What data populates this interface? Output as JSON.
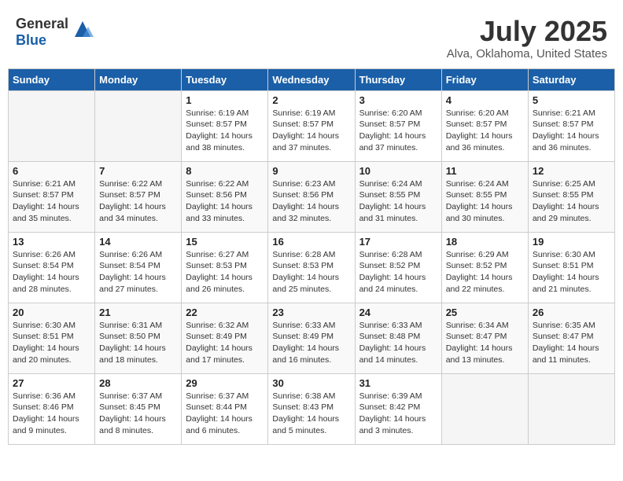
{
  "header": {
    "logo_general": "General",
    "logo_blue": "Blue",
    "month": "July 2025",
    "location": "Alva, Oklahoma, United States"
  },
  "weekdays": [
    "Sunday",
    "Monday",
    "Tuesday",
    "Wednesday",
    "Thursday",
    "Friday",
    "Saturday"
  ],
  "weeks": [
    [
      {
        "day": "",
        "sunrise": "",
        "sunset": "",
        "daylight": ""
      },
      {
        "day": "",
        "sunrise": "",
        "sunset": "",
        "daylight": ""
      },
      {
        "day": "1",
        "sunrise": "Sunrise: 6:19 AM",
        "sunset": "Sunset: 8:57 PM",
        "daylight": "Daylight: 14 hours and 38 minutes."
      },
      {
        "day": "2",
        "sunrise": "Sunrise: 6:19 AM",
        "sunset": "Sunset: 8:57 PM",
        "daylight": "Daylight: 14 hours and 37 minutes."
      },
      {
        "day": "3",
        "sunrise": "Sunrise: 6:20 AM",
        "sunset": "Sunset: 8:57 PM",
        "daylight": "Daylight: 14 hours and 37 minutes."
      },
      {
        "day": "4",
        "sunrise": "Sunrise: 6:20 AM",
        "sunset": "Sunset: 8:57 PM",
        "daylight": "Daylight: 14 hours and 36 minutes."
      },
      {
        "day": "5",
        "sunrise": "Sunrise: 6:21 AM",
        "sunset": "Sunset: 8:57 PM",
        "daylight": "Daylight: 14 hours and 36 minutes."
      }
    ],
    [
      {
        "day": "6",
        "sunrise": "Sunrise: 6:21 AM",
        "sunset": "Sunset: 8:57 PM",
        "daylight": "Daylight: 14 hours and 35 minutes."
      },
      {
        "day": "7",
        "sunrise": "Sunrise: 6:22 AM",
        "sunset": "Sunset: 8:57 PM",
        "daylight": "Daylight: 14 hours and 34 minutes."
      },
      {
        "day": "8",
        "sunrise": "Sunrise: 6:22 AM",
        "sunset": "Sunset: 8:56 PM",
        "daylight": "Daylight: 14 hours and 33 minutes."
      },
      {
        "day": "9",
        "sunrise": "Sunrise: 6:23 AM",
        "sunset": "Sunset: 8:56 PM",
        "daylight": "Daylight: 14 hours and 32 minutes."
      },
      {
        "day": "10",
        "sunrise": "Sunrise: 6:24 AM",
        "sunset": "Sunset: 8:55 PM",
        "daylight": "Daylight: 14 hours and 31 minutes."
      },
      {
        "day": "11",
        "sunrise": "Sunrise: 6:24 AM",
        "sunset": "Sunset: 8:55 PM",
        "daylight": "Daylight: 14 hours and 30 minutes."
      },
      {
        "day": "12",
        "sunrise": "Sunrise: 6:25 AM",
        "sunset": "Sunset: 8:55 PM",
        "daylight": "Daylight: 14 hours and 29 minutes."
      }
    ],
    [
      {
        "day": "13",
        "sunrise": "Sunrise: 6:26 AM",
        "sunset": "Sunset: 8:54 PM",
        "daylight": "Daylight: 14 hours and 28 minutes."
      },
      {
        "day": "14",
        "sunrise": "Sunrise: 6:26 AM",
        "sunset": "Sunset: 8:54 PM",
        "daylight": "Daylight: 14 hours and 27 minutes."
      },
      {
        "day": "15",
        "sunrise": "Sunrise: 6:27 AM",
        "sunset": "Sunset: 8:53 PM",
        "daylight": "Daylight: 14 hours and 26 minutes."
      },
      {
        "day": "16",
        "sunrise": "Sunrise: 6:28 AM",
        "sunset": "Sunset: 8:53 PM",
        "daylight": "Daylight: 14 hours and 25 minutes."
      },
      {
        "day": "17",
        "sunrise": "Sunrise: 6:28 AM",
        "sunset": "Sunset: 8:52 PM",
        "daylight": "Daylight: 14 hours and 24 minutes."
      },
      {
        "day": "18",
        "sunrise": "Sunrise: 6:29 AM",
        "sunset": "Sunset: 8:52 PM",
        "daylight": "Daylight: 14 hours and 22 minutes."
      },
      {
        "day": "19",
        "sunrise": "Sunrise: 6:30 AM",
        "sunset": "Sunset: 8:51 PM",
        "daylight": "Daylight: 14 hours and 21 minutes."
      }
    ],
    [
      {
        "day": "20",
        "sunrise": "Sunrise: 6:30 AM",
        "sunset": "Sunset: 8:51 PM",
        "daylight": "Daylight: 14 hours and 20 minutes."
      },
      {
        "day": "21",
        "sunrise": "Sunrise: 6:31 AM",
        "sunset": "Sunset: 8:50 PM",
        "daylight": "Daylight: 14 hours and 18 minutes."
      },
      {
        "day": "22",
        "sunrise": "Sunrise: 6:32 AM",
        "sunset": "Sunset: 8:49 PM",
        "daylight": "Daylight: 14 hours and 17 minutes."
      },
      {
        "day": "23",
        "sunrise": "Sunrise: 6:33 AM",
        "sunset": "Sunset: 8:49 PM",
        "daylight": "Daylight: 14 hours and 16 minutes."
      },
      {
        "day": "24",
        "sunrise": "Sunrise: 6:33 AM",
        "sunset": "Sunset: 8:48 PM",
        "daylight": "Daylight: 14 hours and 14 minutes."
      },
      {
        "day": "25",
        "sunrise": "Sunrise: 6:34 AM",
        "sunset": "Sunset: 8:47 PM",
        "daylight": "Daylight: 14 hours and 13 minutes."
      },
      {
        "day": "26",
        "sunrise": "Sunrise: 6:35 AM",
        "sunset": "Sunset: 8:47 PM",
        "daylight": "Daylight: 14 hours and 11 minutes."
      }
    ],
    [
      {
        "day": "27",
        "sunrise": "Sunrise: 6:36 AM",
        "sunset": "Sunset: 8:46 PM",
        "daylight": "Daylight: 14 hours and 9 minutes."
      },
      {
        "day": "28",
        "sunrise": "Sunrise: 6:37 AM",
        "sunset": "Sunset: 8:45 PM",
        "daylight": "Daylight: 14 hours and 8 minutes."
      },
      {
        "day": "29",
        "sunrise": "Sunrise: 6:37 AM",
        "sunset": "Sunset: 8:44 PM",
        "daylight": "Daylight: 14 hours and 6 minutes."
      },
      {
        "day": "30",
        "sunrise": "Sunrise: 6:38 AM",
        "sunset": "Sunset: 8:43 PM",
        "daylight": "Daylight: 14 hours and 5 minutes."
      },
      {
        "day": "31",
        "sunrise": "Sunrise: 6:39 AM",
        "sunset": "Sunset: 8:42 PM",
        "daylight": "Daylight: 14 hours and 3 minutes."
      },
      {
        "day": "",
        "sunrise": "",
        "sunset": "",
        "daylight": ""
      },
      {
        "day": "",
        "sunrise": "",
        "sunset": "",
        "daylight": ""
      }
    ]
  ]
}
